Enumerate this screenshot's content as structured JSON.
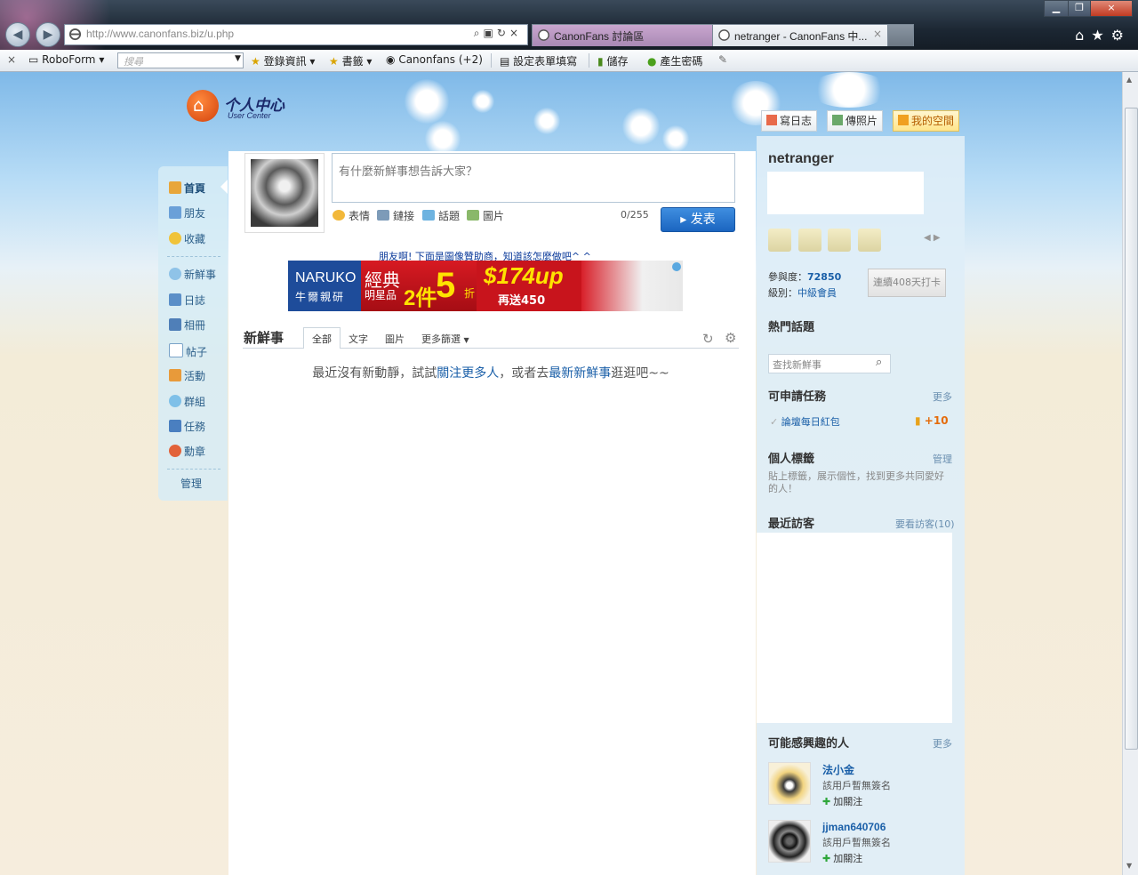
{
  "browser": {
    "url": "http://www.canonfans.biz/u.php",
    "tabs": [
      {
        "title": "CanonFans 討論區"
      },
      {
        "title": "netranger - CanonFans 中..."
      }
    ],
    "close_glyph": "×"
  },
  "commandbar": {
    "roboform": "RoboForm",
    "search_placeholder": "搜尋",
    "login_info": "登錄資訊",
    "bookmarks": "書籤",
    "canonfans": "Canonfans (+2)",
    "form_fill": "設定表單填寫",
    "save": "儲存",
    "gen_password": "產生密碼"
  },
  "logo": {
    "title": "个人中心",
    "subtitle": "User Center"
  },
  "nav": {
    "items": [
      {
        "label": "首頁",
        "icon": "home-icon"
      },
      {
        "label": "朋友",
        "icon": "friends-icon"
      },
      {
        "label": "收藏",
        "icon": "star-icon"
      },
      {
        "label": "新鮮事",
        "icon": "bubble-icon"
      },
      {
        "label": "日誌",
        "icon": "diary-icon"
      },
      {
        "label": "相冊",
        "icon": "album-icon"
      },
      {
        "label": "帖子",
        "icon": "post-icon"
      },
      {
        "label": "活動",
        "icon": "event-icon"
      },
      {
        "label": "群組",
        "icon": "group-icon"
      },
      {
        "label": "任務",
        "icon": "task-icon"
      },
      {
        "label": "勳章",
        "icon": "medal-icon"
      }
    ],
    "manage": "管理"
  },
  "composer": {
    "placeholder": "有什麼新鮮事想告訴大家？",
    "tools": [
      "表情",
      "鏈接",
      "話題",
      "圖片"
    ],
    "counter": "0/255",
    "publish": "发表"
  },
  "sponsor_note": "朋友啊! 下面是圖像贊助商，知道該怎麼做吧^ ^",
  "ad": {
    "brand_en": "NARUKO",
    "brand_zh": "牛爾親研",
    "line1": "經典",
    "line2": "明星品",
    "count": "2件",
    "discount": "5",
    "discount_unit": "折",
    "price": "$174up",
    "gift": "再送450"
  },
  "feed": {
    "title": "新鮮事",
    "tabs": [
      "全部",
      "文字",
      "圖片",
      "更多篩選"
    ],
    "empty_prefix": "最近沒有新動靜，試試",
    "empty_link1": "關注更多人",
    "empty_mid": "，或者去",
    "empty_link2": "最新新鮮事",
    "empty_suffix": "逛逛吧~~"
  },
  "right_buttons": [
    "寫日志",
    "傳照片",
    "我的空間"
  ],
  "profile": {
    "username": "netranger",
    "participation_label": "參與度：",
    "participation": "72850",
    "level_label": "級別：",
    "level": "中級會員",
    "checkin": "連續408天打卡"
  },
  "hot_topics": {
    "title": "熱門話題",
    "search_placeholder": "查找新鮮事"
  },
  "tasks": {
    "title": "可申請任務",
    "more": "更多",
    "item": "論壇每日紅包",
    "reward": "+10"
  },
  "tags": {
    "title": "個人標籤",
    "manage": "管理",
    "tip": "貼上標籤，展示個性，找到更多共同愛好的人！"
  },
  "visitors": {
    "title": "最近訪客",
    "more": "要看訪客(10)"
  },
  "people": {
    "title": "可能感興趣的人",
    "more": "更多",
    "list": [
      {
        "name": "法小金",
        "sig": "該用戶暫無簽名",
        "follow": "加關注"
      },
      {
        "name": "jjman640706",
        "sig": "該用戶暫無簽名",
        "follow": "加關注"
      }
    ]
  }
}
